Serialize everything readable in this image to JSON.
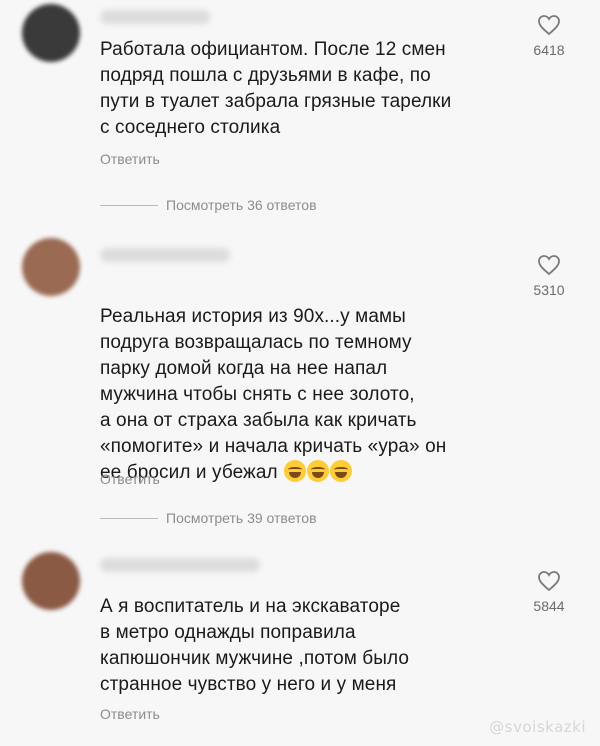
{
  "comments": [
    {
      "text": "Работала официантом. После 12 смен\nподряд пошла с друзьями в кафе, по\nпути в туалет забрала грязные тарелки\nс соседнего столика",
      "likes": "6418",
      "reply_label": "Ответить",
      "view_replies": "Посмотреть 36 ответов",
      "avatar_color": "#3a3a3a"
    },
    {
      "text": "Реальная история из 90х...у мамы\nподруга возвращалась по темному\nпарку домой когда на нее напал\nмужчина чтобы снять с нее золото,\nа она от страха забыла как кричать\n«помогите» и начала кричать «ура» он\nее бросил и убежал",
      "likes": "5310",
      "reply_label": "Ответить",
      "view_replies": "Посмотреть 39 ответов",
      "avatar_color": "#9a6a52"
    },
    {
      "text": "А я воспитатель и на экскаваторе\nв метро однажды  поправила\nкапюшончик мужчине ,потом было\nстранное чувство у него и у меня",
      "likes": "5844",
      "reply_label": "Ответить",
      "avatar_color": "#8a5a44"
    }
  ],
  "watermark": "@svoiskazki",
  "icons": {
    "like": "heart-outline-icon",
    "emoji": "laughing-tears-emoji-icon"
  }
}
